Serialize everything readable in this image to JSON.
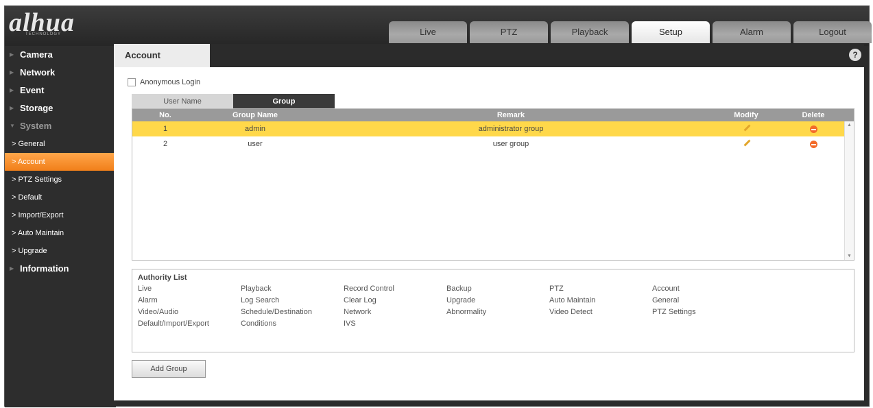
{
  "header": {
    "logo": "alhua",
    "logo_sub": "TECHNOLOGY",
    "tabs": [
      "Live",
      "PTZ",
      "Playback",
      "Setup",
      "Alarm",
      "Logout"
    ]
  },
  "sidebar": {
    "items": [
      {
        "label": "Camera"
      },
      {
        "label": "Network"
      },
      {
        "label": "Event"
      },
      {
        "label": "Storage"
      },
      {
        "label": "System"
      },
      {
        "label": "> General"
      },
      {
        "label": "> Account"
      },
      {
        "label": "> PTZ Settings"
      },
      {
        "label": "> Default"
      },
      {
        "label": "> Import/Export"
      },
      {
        "label": "> Auto Maintain"
      },
      {
        "label": "> Upgrade"
      },
      {
        "label": "Information"
      }
    ]
  },
  "page": {
    "tab_title": "Account",
    "help": "?",
    "anonymous_login": "Anonymous Login",
    "subtabs": [
      "User Name",
      "Group"
    ]
  },
  "table": {
    "headers": [
      "No.",
      "Group Name",
      "Remark",
      "Modify",
      "Delete"
    ],
    "rows": [
      {
        "no": "1",
        "name": "admin",
        "remark": "administrator group"
      },
      {
        "no": "2",
        "name": "user",
        "remark": "user group"
      }
    ]
  },
  "authority": {
    "title": "Authority List",
    "items": [
      "Live",
      "Playback",
      "Record Control",
      "Backup",
      "PTZ",
      "Account",
      "Alarm",
      "Log Search",
      "Clear Log",
      "Upgrade",
      "Auto Maintain",
      "General",
      "Video/Audio",
      "Schedule/Destination",
      "Network",
      "Abnormality",
      "Video Detect",
      "PTZ Settings",
      "Default/Import/Export",
      "Conditions",
      "IVS"
    ]
  },
  "actions": {
    "add_group": "Add Group"
  },
  "colors": {
    "accent": "#f17f1a",
    "selected_row": "#ffd84a",
    "frame": "#2b2b2b"
  }
}
